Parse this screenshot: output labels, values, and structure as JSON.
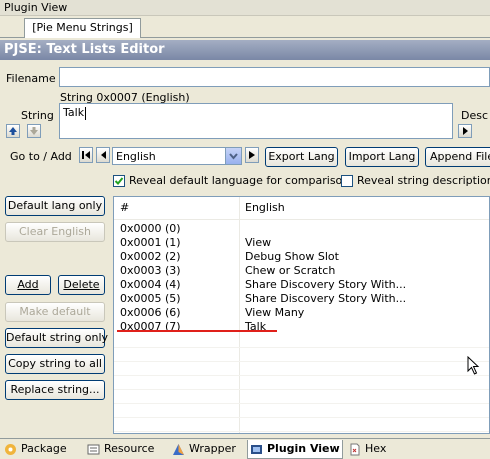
{
  "window_title": "Plugin View",
  "document_tab": "[Pie Menu Strings]",
  "editor_title": "PJSE: Text Lists Editor",
  "filename": {
    "label": "Filename",
    "value": ""
  },
  "string": {
    "label": "String",
    "caption": "String 0x0007 (English)",
    "value": "Talk",
    "desc_label": "Desc"
  },
  "goto": {
    "label": "Go to / Add",
    "language": "English",
    "export_label": "Export Lang",
    "import_label": "Import Lang",
    "append_label": "Append File"
  },
  "options": {
    "reveal_default": {
      "label": "Reveal default language for comparison",
      "checked": true
    },
    "reveal_desc": {
      "label": "Reveal string descriptions",
      "checked": false
    }
  },
  "side_buttons": {
    "default_lang_only": "Default lang only",
    "clear_english": "Clear English",
    "add": "Add",
    "delete": "Delete",
    "make_default": "Make default",
    "default_string_only": "Default string only",
    "copy_string_to_all": "Copy string to all",
    "replace_string": "Replace string..."
  },
  "table": {
    "columns": [
      "#",
      "English"
    ],
    "rows": [
      {
        "id": "0x0000 (0)",
        "text": ""
      },
      {
        "id": "0x0001 (1)",
        "text": "View"
      },
      {
        "id": "0x0002 (2)",
        "text": "Debug Show Slot"
      },
      {
        "id": "0x0003 (3)",
        "text": "Chew or Scratch"
      },
      {
        "id": "0x0004 (4)",
        "text": "Share Discovery Story With..."
      },
      {
        "id": "0x0005 (5)",
        "text": "Share Discovery Story With..."
      },
      {
        "id": "0x0006 (6)",
        "text": "View Many"
      },
      {
        "id": "0x0007 (7)",
        "text": "Talk"
      }
    ],
    "selected_index": 7
  },
  "bottom_tabs": [
    {
      "label": "Package",
      "icon": "package-icon",
      "active": false
    },
    {
      "label": "Resource",
      "icon": "resource-icon",
      "active": false
    },
    {
      "label": "Wrapper",
      "icon": "wrapper-icon",
      "active": false
    },
    {
      "label": "Plugin View",
      "icon": "plugin-view-icon",
      "active": true
    },
    {
      "label": "Hex",
      "icon": "hex-icon",
      "active": false
    }
  ],
  "colors": {
    "header": "#7a87a6",
    "underline": "#e0201a",
    "button_border": "#003c74"
  }
}
